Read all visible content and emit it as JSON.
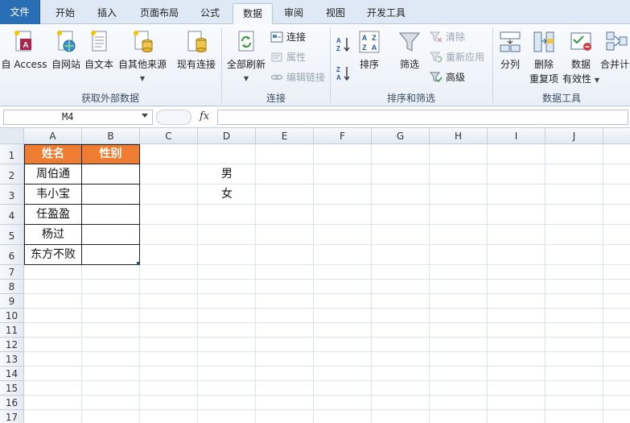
{
  "tabs": [
    "文件",
    "开始",
    "插入",
    "页面布局",
    "公式",
    "数据",
    "审阅",
    "视图",
    "开发工具"
  ],
  "active_tab": "数据",
  "ribbon": {
    "external": {
      "group_label": "获取外部数据",
      "access": "自 Access",
      "web": "自网站",
      "text": "自文本",
      "other": "自其他来源",
      "existing": "现有连接"
    },
    "connections": {
      "group_label": "连接",
      "refresh_all": "全部刷新",
      "connections": "连接",
      "properties": "属性",
      "edit_links": "编辑链接"
    },
    "sort_filter": {
      "group_label": "排序和筛选",
      "sort": "排序",
      "filter": "筛选",
      "clear": "清除",
      "reapply": "重新应用",
      "advanced": "高级"
    },
    "data_tools": {
      "group_label": "数据工具",
      "text_to_columns": "分列",
      "remove_dup_1": "删除",
      "remove_dup_2": "重复项",
      "validation_1": "数据",
      "validation_2": "有效性",
      "consolidate": "合并计"
    }
  },
  "formula_bar": {
    "name_box": "M4",
    "fx": "fx",
    "formula": ""
  },
  "columns": [
    "A",
    "B",
    "C",
    "D",
    "E",
    "F",
    "G",
    "H",
    "I",
    "J"
  ],
  "rows": [
    "1",
    "2",
    "3",
    "4",
    "5",
    "6",
    "7",
    "8",
    "9",
    "10",
    "11",
    "12",
    "13",
    "14",
    "15",
    "16",
    "17"
  ],
  "table": {
    "header_name": "姓名",
    "header_gender": "性别",
    "names": [
      "周伯通",
      "韦小宝",
      "任盈盈",
      "杨过",
      "东方不败"
    ]
  },
  "d_column": [
    "男",
    "女"
  ],
  "colors": {
    "header_fill": "#ee7d31",
    "file_tab": "#2a6fb6"
  }
}
